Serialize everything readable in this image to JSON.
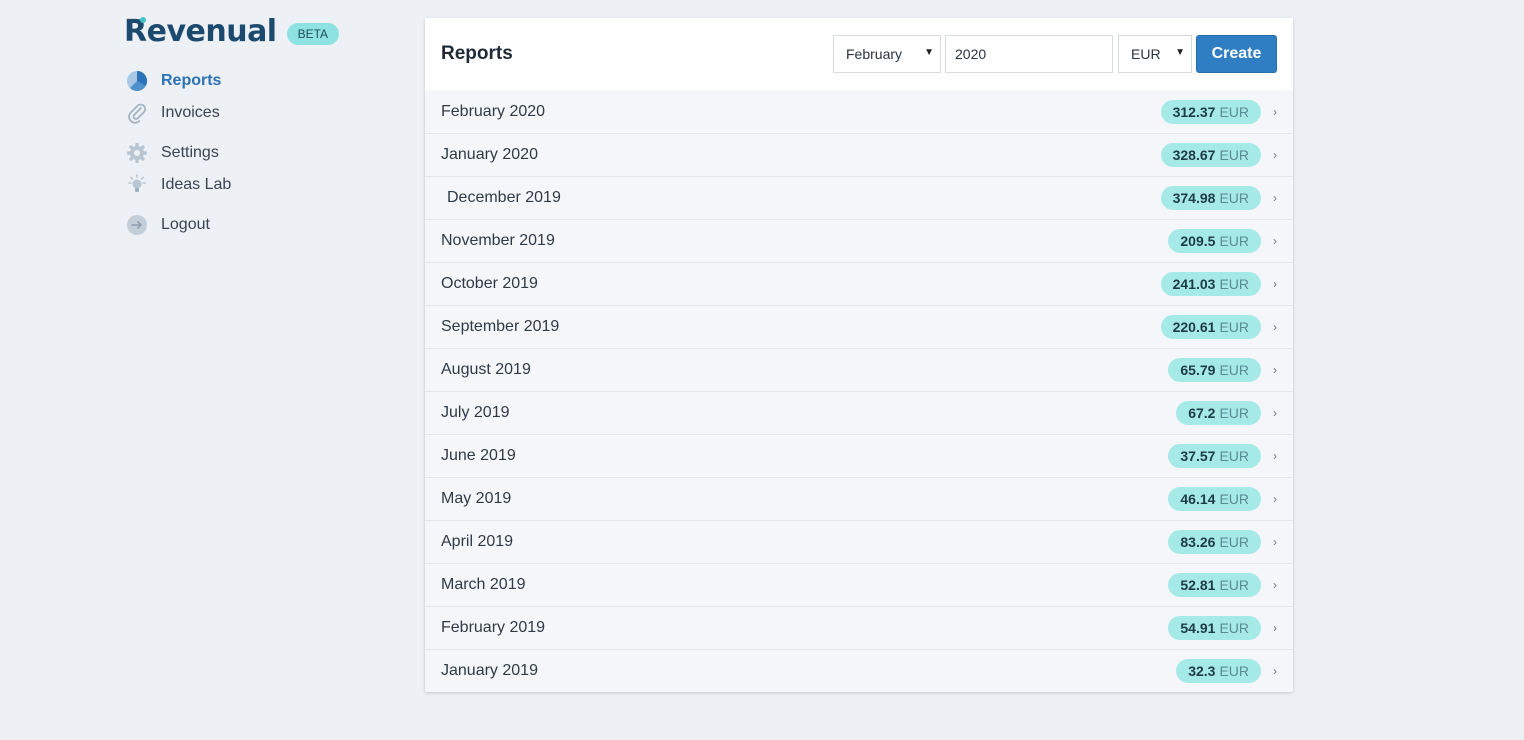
{
  "brand": {
    "name": "Revenual",
    "badge": "BETA"
  },
  "colors": {
    "accent": "#2f7ec4",
    "brand": "#1c4a6e",
    "pill": "#a6eae8"
  },
  "sidebar": {
    "items": [
      {
        "label": "Reports",
        "icon": "pie-chart-icon",
        "active": true
      },
      {
        "label": "Invoices",
        "icon": "paperclip-icon"
      },
      {
        "label": "Settings",
        "icon": "gear-icon"
      },
      {
        "label": "Ideas Lab",
        "icon": "lightbulb-icon"
      },
      {
        "label": "Logout",
        "icon": "logout-icon"
      }
    ]
  },
  "reports": {
    "title": "Reports",
    "form": {
      "month": "February",
      "year": "2020",
      "currency": "EUR",
      "create_label": "Create"
    },
    "rows": [
      {
        "label": "February 2020",
        "amount": "312.37",
        "currency": "EUR"
      },
      {
        "label": "January 2020",
        "amount": "328.67",
        "currency": "EUR"
      },
      {
        "label": "December 2019",
        "amount": "374.98",
        "currency": "EUR"
      },
      {
        "label": "November 2019",
        "amount": "209.5",
        "currency": "EUR"
      },
      {
        "label": "October 2019",
        "amount": "241.03",
        "currency": "EUR"
      },
      {
        "label": "September 2019",
        "amount": "220.61",
        "currency": "EUR"
      },
      {
        "label": "August 2019",
        "amount": "65.79",
        "currency": "EUR"
      },
      {
        "label": "July 2019",
        "amount": "67.2",
        "currency": "EUR"
      },
      {
        "label": "June 2019",
        "amount": "37.57",
        "currency": "EUR"
      },
      {
        "label": "May 2019",
        "amount": "46.14",
        "currency": "EUR"
      },
      {
        "label": "April 2019",
        "amount": "83.26",
        "currency": "EUR"
      },
      {
        "label": "March 2019",
        "amount": "52.81",
        "currency": "EUR"
      },
      {
        "label": "February 2019",
        "amount": "54.91",
        "currency": "EUR"
      },
      {
        "label": "January 2019",
        "amount": "32.3",
        "currency": "EUR"
      }
    ]
  }
}
